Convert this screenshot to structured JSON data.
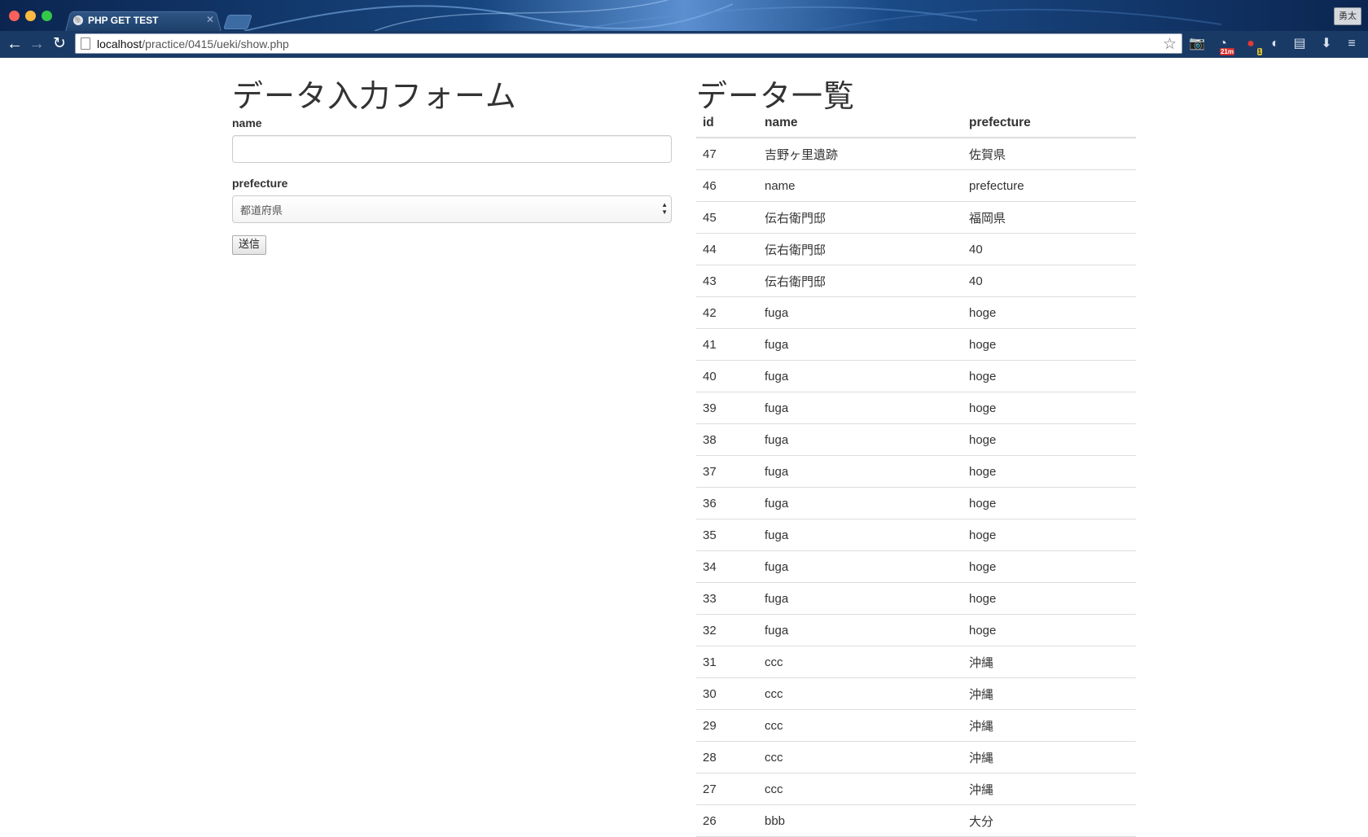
{
  "browser": {
    "tab_title": "PHP GET TEST",
    "url_host": "localhost",
    "url_path": "/practice/0415/ueki/show.php",
    "profile_name": "勇太",
    "ext_badge_timer": "21m",
    "ext_badge_count": "1"
  },
  "form": {
    "title": "データ入力フォーム",
    "name_label": "name",
    "name_value": "",
    "prefecture_label": "prefecture",
    "prefecture_selected": "都道府県",
    "submit_label": "送信"
  },
  "list": {
    "title": "データ一覧",
    "columns": [
      "id",
      "name",
      "prefecture"
    ],
    "rows": [
      {
        "id": "47",
        "name": "吉野ヶ里遺跡",
        "prefecture": "佐賀県"
      },
      {
        "id": "46",
        "name": "name",
        "prefecture": "prefecture"
      },
      {
        "id": "45",
        "name": "伝右衛門邸",
        "prefecture": "福岡県"
      },
      {
        "id": "44",
        "name": "伝右衛門邸",
        "prefecture": "40"
      },
      {
        "id": "43",
        "name": "伝右衛門邸",
        "prefecture": "40"
      },
      {
        "id": "42",
        "name": "fuga",
        "prefecture": "hoge"
      },
      {
        "id": "41",
        "name": "fuga",
        "prefecture": "hoge"
      },
      {
        "id": "40",
        "name": "fuga",
        "prefecture": "hoge"
      },
      {
        "id": "39",
        "name": "fuga",
        "prefecture": "hoge"
      },
      {
        "id": "38",
        "name": "fuga",
        "prefecture": "hoge"
      },
      {
        "id": "37",
        "name": "fuga",
        "prefecture": "hoge"
      },
      {
        "id": "36",
        "name": "fuga",
        "prefecture": "hoge"
      },
      {
        "id": "35",
        "name": "fuga",
        "prefecture": "hoge"
      },
      {
        "id": "34",
        "name": "fuga",
        "prefecture": "hoge"
      },
      {
        "id": "33",
        "name": "fuga",
        "prefecture": "hoge"
      },
      {
        "id": "32",
        "name": "fuga",
        "prefecture": "hoge"
      },
      {
        "id": "31",
        "name": "ccc",
        "prefecture": "沖縄"
      },
      {
        "id": "30",
        "name": "ccc",
        "prefecture": "沖縄"
      },
      {
        "id": "29",
        "name": "ccc",
        "prefecture": "沖縄"
      },
      {
        "id": "28",
        "name": "ccc",
        "prefecture": "沖縄"
      },
      {
        "id": "27",
        "name": "ccc",
        "prefecture": "沖縄"
      },
      {
        "id": "26",
        "name": "bbb",
        "prefecture": "大分"
      }
    ]
  }
}
